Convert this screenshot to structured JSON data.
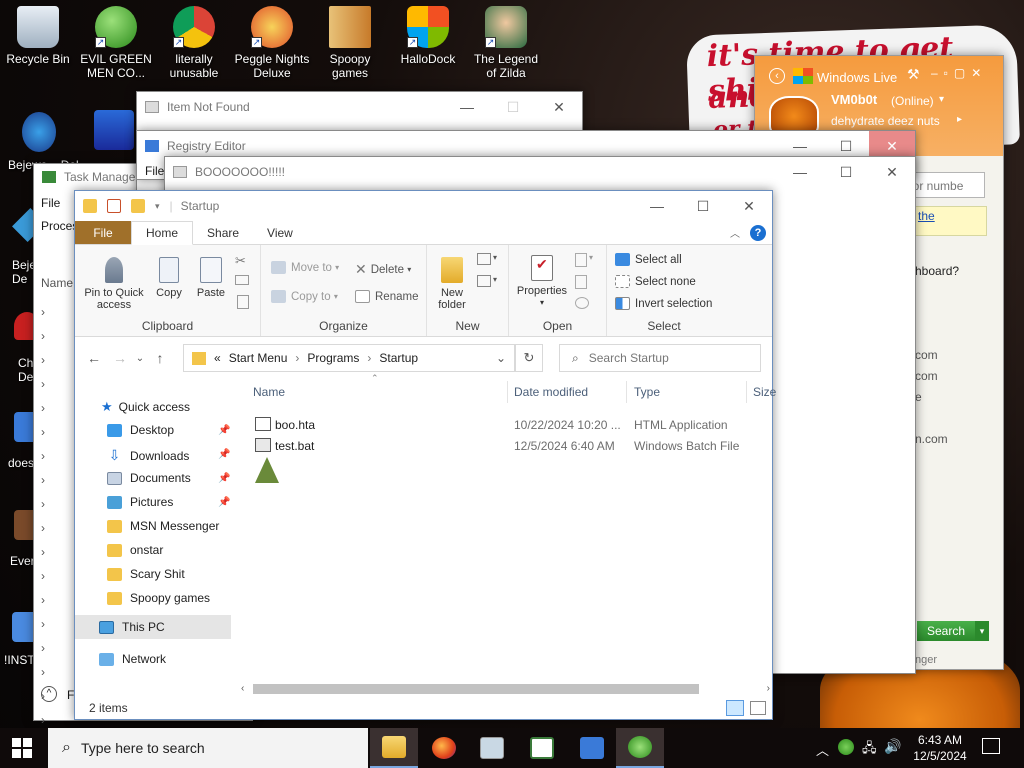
{
  "desktop": {
    "icons": [
      {
        "label": "Recycle Bin"
      },
      {
        "label": "EVIL GREEN MEN CO..."
      },
      {
        "label": "literally unusable"
      },
      {
        "label": "Peggle Nights Deluxe"
      },
      {
        "label": "Spoopy games"
      },
      {
        "label": "HalloDock"
      },
      {
        "label": "The Legend of Zilda"
      }
    ],
    "left_peek": [
      "Bejewe... Del",
      "Beje... De",
      "Ch... De",
      "does",
      "Ever",
      "!INSTA"
    ],
    "scrawl": [
      "it's time to get shit",
      "and",
      "or t"
    ]
  },
  "windows": {
    "item_not_found": {
      "title": "Item Not Found"
    },
    "registry_editor": {
      "title": "Registry Editor",
      "menu_file": "File"
    },
    "task_manager": {
      "title": "Task Manager",
      "menu_file": "File",
      "tab_processes": "Proces",
      "col_name": "Name",
      "footer_f": "F"
    },
    "boo": {
      "title": "BOOOOOOO!!!!!"
    }
  },
  "explorer": {
    "title": "Startup",
    "tabs": [
      "File",
      "Home",
      "Share",
      "View"
    ],
    "ribbon": {
      "clipboard": {
        "pin": "Pin to Quick access",
        "copy": "Copy",
        "paste": "Paste",
        "label": "Clipboard"
      },
      "organize": {
        "move_to": "Move to",
        "copy_to": "Copy to",
        "delete": "Delete",
        "rename": "Rename",
        "label": "Organize"
      },
      "new": {
        "new_folder": "New folder",
        "label": "New"
      },
      "open": {
        "properties": "Properties",
        "label": "Open"
      },
      "select": {
        "select_all": "Select all",
        "select_none": "Select none",
        "invert": "Invert selection",
        "label": "Select"
      }
    },
    "address": {
      "chevrons": "«",
      "path": [
        "Start Menu",
        "Programs",
        "Startup"
      ]
    },
    "search_placeholder": "Search Startup",
    "nav_pane": {
      "quick_access": "Quick access",
      "pinned": [
        "Desktop",
        "Downloads",
        "Documents",
        "Pictures"
      ],
      "folders": [
        "MSN Messenger",
        "onstar",
        "Scary Shit",
        "Spoopy games"
      ],
      "this_pc": "This PC",
      "network": "Network"
    },
    "columns": {
      "name": "Name",
      "date": "Date modified",
      "type": "Type",
      "size": "Size"
    },
    "files": [
      {
        "name": "boo.hta",
        "date": "10/22/2024 10:20 ...",
        "type": "HTML Application"
      },
      {
        "name": "test.bat",
        "date": "12/5/2024 6:40 AM",
        "type": "Windows Batch File"
      }
    ],
    "status": "2 items"
  },
  "msn": {
    "title": "Windows Live",
    "username": "VM0b0t",
    "status": "(Online)",
    "personal_message": "dehydrate deez nuts",
    "search_placeholder": "ct or numbe",
    "link": "the",
    "question": "hboard?",
    "contacts": [
      "com",
      "com",
      "e",
      "n.com"
    ],
    "search_button": "Search",
    "footer": "nger"
  },
  "taskbar": {
    "search_placeholder": "Type here to search",
    "time": "6:43 AM",
    "date": "12/5/2024"
  },
  "colors": {
    "file_tab": "#a0702a",
    "msn_orange": "#f59b3e",
    "accent_blue": "#1a6fd1",
    "selection": "#cce8ff"
  }
}
